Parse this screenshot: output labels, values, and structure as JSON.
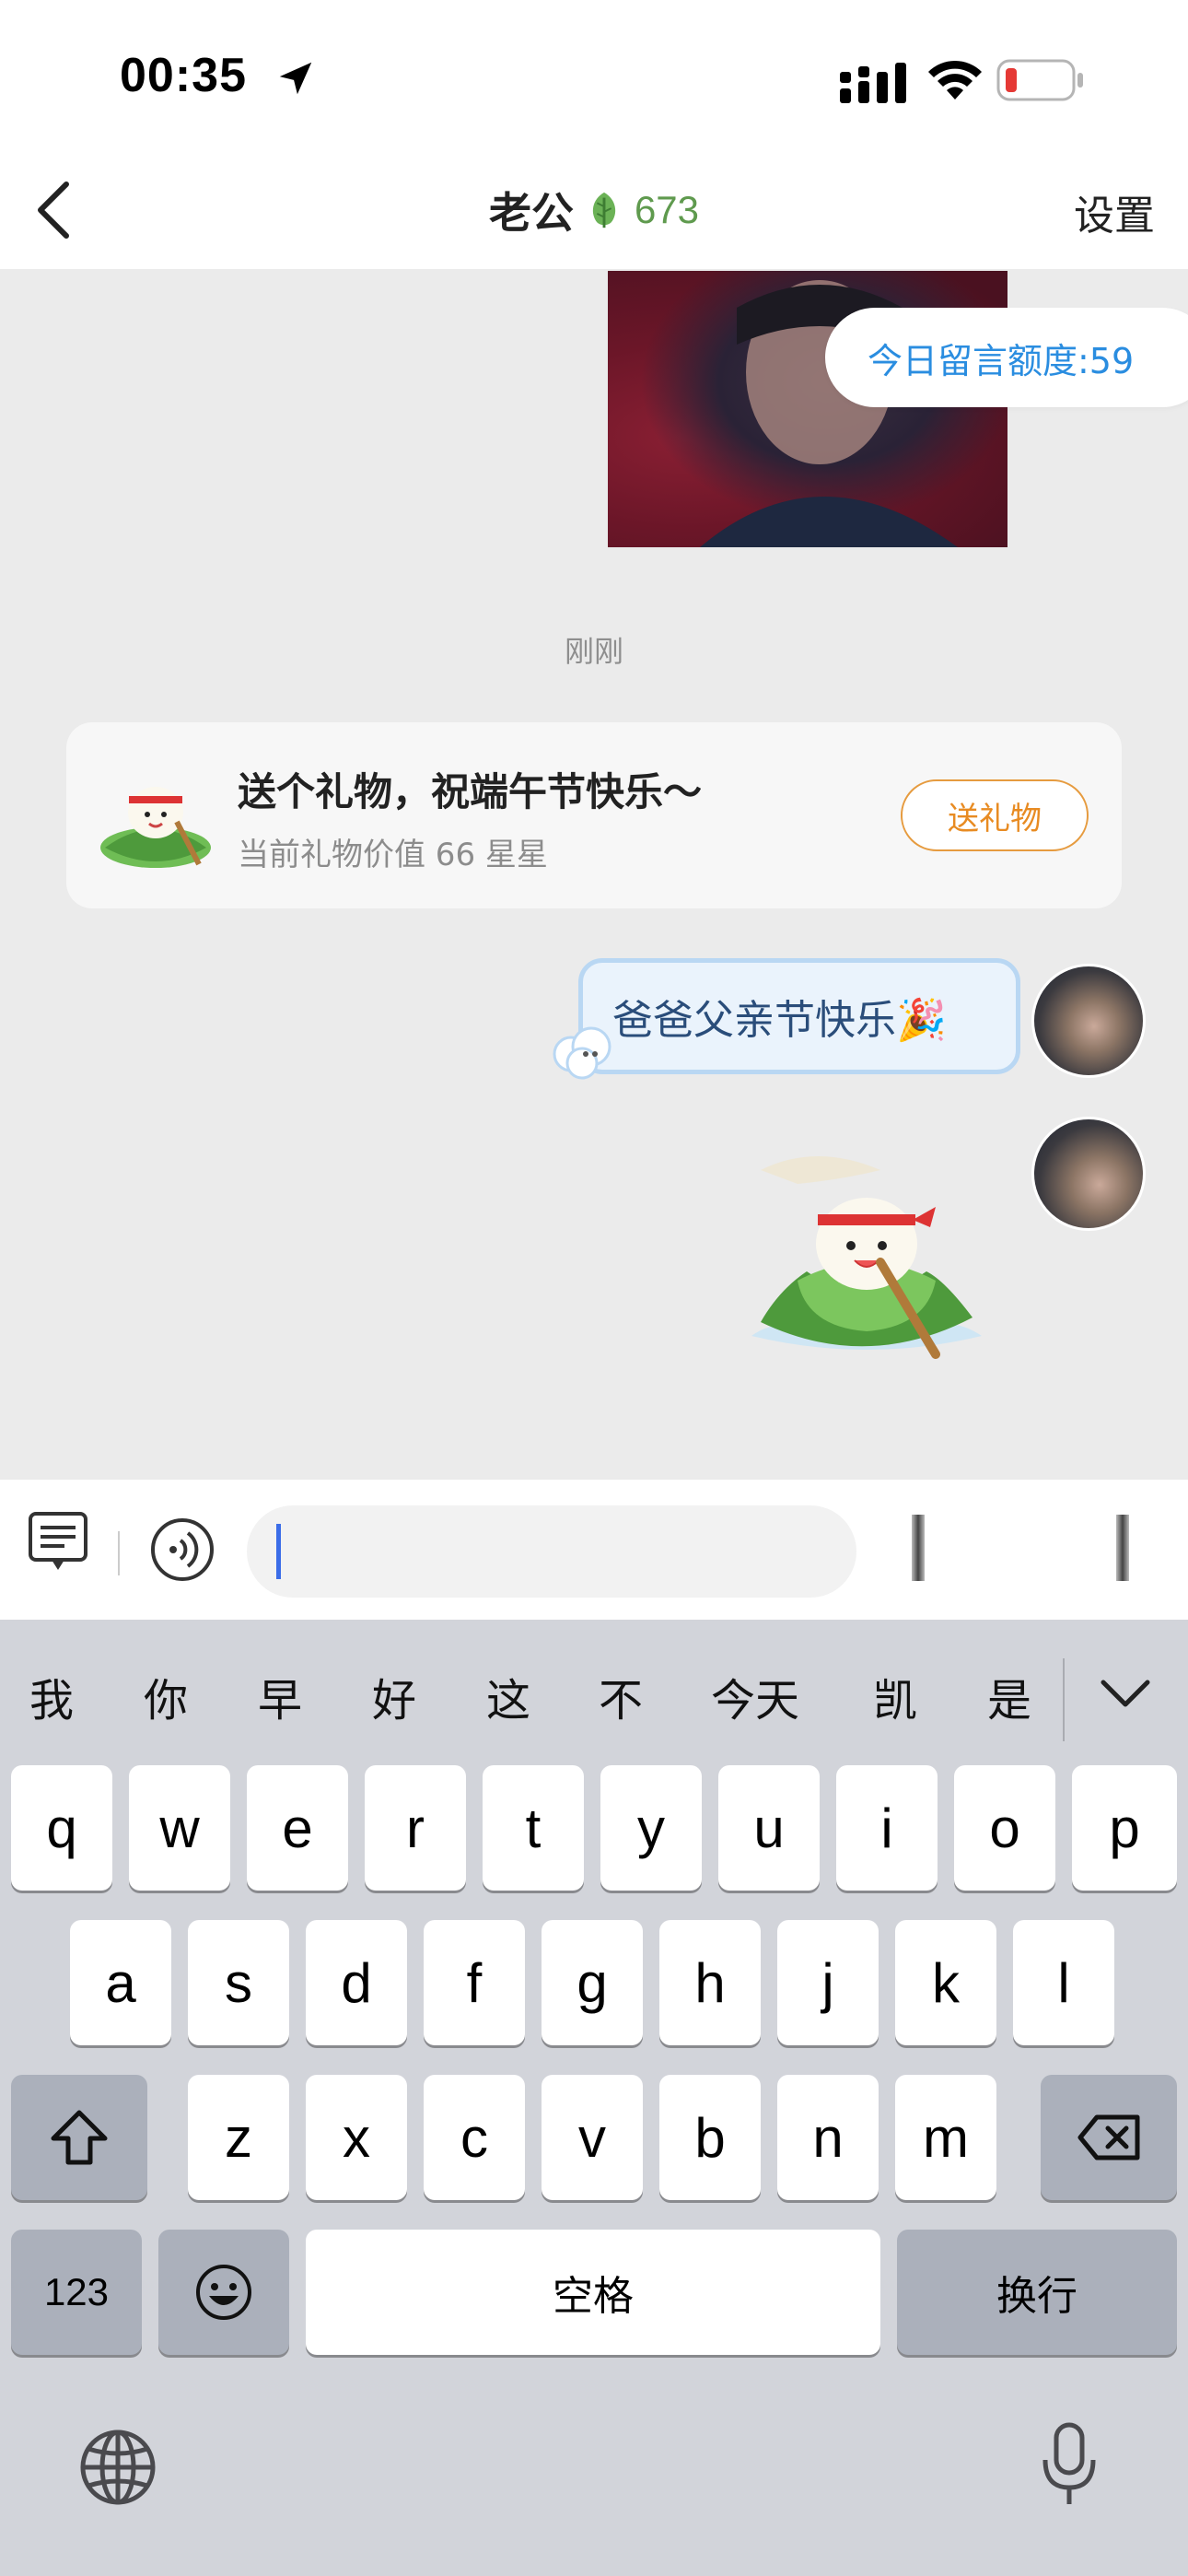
{
  "status_bar": {
    "time": "00:35",
    "battery_color": "#e53935"
  },
  "nav": {
    "title": "老公",
    "intimacy_score": "673",
    "settings_label": "设置"
  },
  "chat": {
    "quota_text": "今日留言额度:59",
    "time_label": "刚刚",
    "gift_card": {
      "title": "送个礼物，祝端午节快乐～",
      "subtitle": "当前礼物价值 66 星星",
      "button_label": "送礼物"
    },
    "text_message": "爸爸父亲节快乐🎉"
  },
  "input": {
    "value": "",
    "placeholder": ""
  },
  "keyboard": {
    "candidates": [
      "我",
      "你",
      "早",
      "好",
      "这",
      "不",
      "今天",
      "凯",
      "是"
    ],
    "row1": [
      "q",
      "w",
      "e",
      "r",
      "t",
      "y",
      "u",
      "i",
      "o",
      "p"
    ],
    "row2": [
      "a",
      "s",
      "d",
      "f",
      "g",
      "h",
      "j",
      "k",
      "l"
    ],
    "row3": [
      "z",
      "x",
      "c",
      "v",
      "b",
      "n",
      "m"
    ],
    "numbers_label": "123",
    "space_label": "空格",
    "return_label": "换行"
  },
  "colors": {
    "accent_blue": "#2a8de0",
    "gift_orange": "#e88b22",
    "leaf_green": "#5f9a4e"
  }
}
